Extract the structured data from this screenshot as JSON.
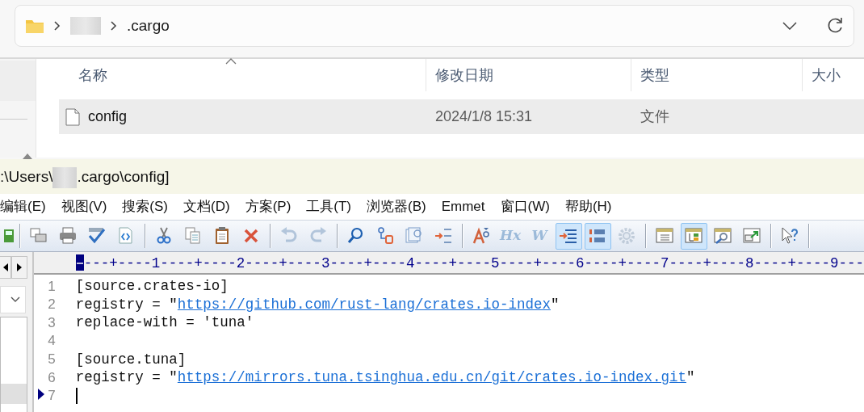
{
  "explorer": {
    "path": [
      {
        "kind": "redacted"
      },
      {
        "kind": "folder",
        "name": ".cargo"
      }
    ],
    "columns": [
      {
        "label": "名称",
        "sorted": true
      },
      {
        "label": "修改日期",
        "sorted": false
      },
      {
        "label": "类型",
        "sorted": false
      },
      {
        "label": "大小",
        "sorted": false
      }
    ],
    "rows": [
      {
        "name": "config",
        "date": "2024/1/8 15:31",
        "type": "文件",
        "selected": true
      }
    ]
  },
  "editor": {
    "title": {
      "before": ":\\Users\\",
      "after": ".cargo\\config]"
    },
    "menu": [
      "编辑(E)",
      "视图(V)",
      "搜索(S)",
      "文档(D)",
      "方案(P)",
      "工具(T)",
      "浏览器(B)",
      "Emmet",
      "窗口(W)",
      "帮助(H)"
    ],
    "toolbar": [
      {
        "kind": "button",
        "active": false,
        "disabled": false
      },
      {
        "kind": "separator"
      },
      {
        "kind": "button",
        "active": false,
        "disabled": false
      },
      {
        "kind": "button",
        "active": false,
        "disabled": false
      },
      {
        "kind": "button",
        "active": false,
        "disabled": false
      },
      {
        "kind": "button",
        "active": false,
        "disabled": false
      },
      {
        "kind": "separator"
      },
      {
        "kind": "button",
        "active": false,
        "disabled": false
      },
      {
        "kind": "button",
        "active": false,
        "disabled": false
      },
      {
        "kind": "button",
        "active": false,
        "disabled": false
      },
      {
        "kind": "button",
        "active": false,
        "disabled": false
      },
      {
        "kind": "separator"
      },
      {
        "kind": "button",
        "active": false,
        "disabled": true
      },
      {
        "kind": "button",
        "active": false,
        "disabled": true
      },
      {
        "kind": "separator"
      },
      {
        "kind": "button",
        "active": false,
        "disabled": false
      },
      {
        "kind": "button",
        "active": false,
        "disabled": false
      },
      {
        "kind": "button",
        "active": false,
        "disabled": false
      },
      {
        "kind": "button",
        "active": false,
        "disabled": false
      },
      {
        "kind": "separator"
      },
      {
        "kind": "button",
        "active": false,
        "disabled": false
      },
      {
        "kind": "button",
        "active": false,
        "disabled": true,
        "glyph": "Hx"
      },
      {
        "kind": "button",
        "active": false,
        "disabled": true,
        "glyph": "W"
      },
      {
        "kind": "button",
        "active": true,
        "disabled": false
      },
      {
        "kind": "button",
        "active": true,
        "disabled": false
      },
      {
        "kind": "button",
        "active": false,
        "disabled": true
      },
      {
        "kind": "separator"
      },
      {
        "kind": "button",
        "active": false,
        "disabled": false
      },
      {
        "kind": "button",
        "active": true,
        "disabled": false
      },
      {
        "kind": "button",
        "active": false,
        "disabled": false
      },
      {
        "kind": "button",
        "active": false,
        "disabled": false
      },
      {
        "kind": "separator"
      },
      {
        "kind": "button",
        "active": false,
        "disabled": false
      },
      {
        "kind": "separator"
      }
    ],
    "side_panel": {
      "list_items": [
        {
          "selected": true
        }
      ]
    },
    "ruler": "---+----1----+----2----+----3----+----4----+----5----+----6----+----7----+----8----+----9---",
    "lines": [
      {
        "number": "1",
        "current": false,
        "segments": [
          {
            "kind": "plain",
            "text": "[source.crates-io]"
          }
        ]
      },
      {
        "number": "2",
        "current": false,
        "segments": [
          {
            "kind": "plain",
            "text": "registry = \""
          },
          {
            "kind": "link",
            "text": "https://github.com/rust-lang/crates.io-index"
          },
          {
            "kind": "plain",
            "text": "\""
          }
        ]
      },
      {
        "number": "3",
        "current": false,
        "segments": [
          {
            "kind": "plain",
            "text": "replace-with = 'tuna'"
          }
        ]
      },
      {
        "number": "4",
        "current": false
      },
      {
        "number": "5",
        "current": false,
        "segments": [
          {
            "kind": "plain",
            "text": "[source.tuna]"
          }
        ]
      },
      {
        "number": "6",
        "current": false,
        "segments": [
          {
            "kind": "plain",
            "text": "registry = \""
          },
          {
            "kind": "link",
            "text": "https://mirrors.tuna.tsinghua.edu.cn/git/crates.io-index.git"
          },
          {
            "kind": "plain",
            "text": "\""
          }
        ]
      },
      {
        "number": "7",
        "current": true
      }
    ]
  }
}
